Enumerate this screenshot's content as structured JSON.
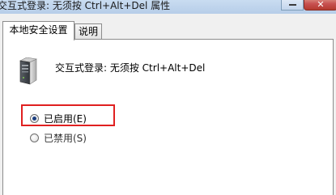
{
  "window": {
    "title": "交互式登录: 无须按 Ctrl+Alt+Del 属性",
    "close_glyph": "✕"
  },
  "tabs": [
    {
      "label": "本地安全设置",
      "active": true
    },
    {
      "label": "说明",
      "active": false
    }
  ],
  "policy": {
    "icon": "server-icon",
    "text": "交互式登录: 无须按 Ctrl+Alt+Del"
  },
  "options": [
    {
      "label": "已启用(E)",
      "selected": true
    },
    {
      "label": "已禁用(S)",
      "selected": false
    }
  ],
  "colors": {
    "highlight": "#e02020",
    "titlebar": "#c9dcf1",
    "close_button": "#c75050"
  }
}
